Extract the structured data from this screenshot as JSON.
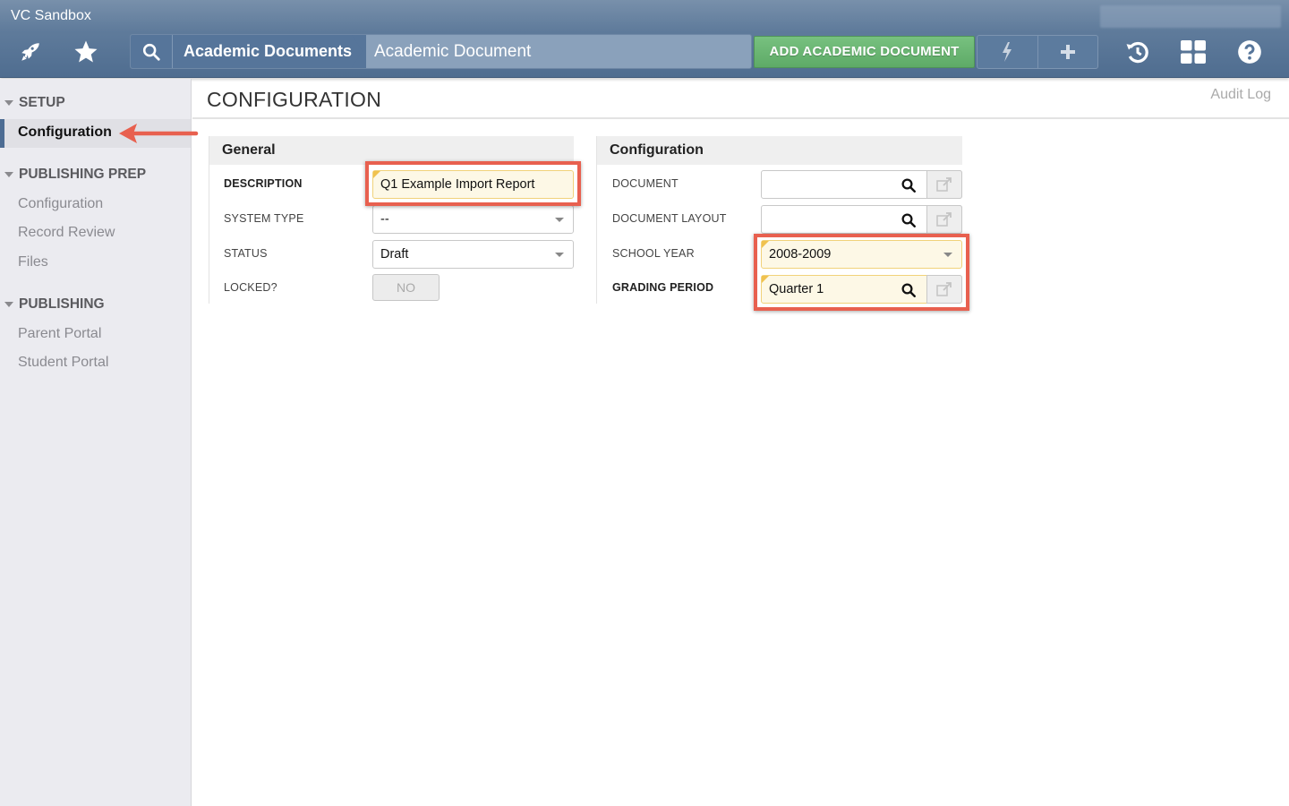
{
  "app": {
    "title": "VC Sandbox"
  },
  "header": {
    "icons": [
      "rocket-icon",
      "star-icon",
      "search-icon",
      "lightning-icon",
      "plus-icon",
      "history-icon",
      "apps-grid-icon",
      "help-icon"
    ],
    "breadcrumb": [
      "Academic Documents",
      "Academic Document"
    ],
    "add_button_label": "ADD ACADEMIC DOCUMENT"
  },
  "sidebar": {
    "sections": [
      {
        "label": "SETUP",
        "items": [
          {
            "label": "Configuration",
            "active": true
          }
        ]
      },
      {
        "label": "PUBLISHING PREP",
        "items": [
          {
            "label": "Configuration"
          },
          {
            "label": "Record Review"
          },
          {
            "label": "Files"
          }
        ]
      },
      {
        "label": "PUBLISHING",
        "items": [
          {
            "label": "Parent Portal"
          },
          {
            "label": "Student Portal"
          }
        ]
      }
    ]
  },
  "main": {
    "title": "CONFIGURATION",
    "audit_log_label": "Audit Log",
    "general": {
      "heading": "General",
      "fields": [
        {
          "label": "DESCRIPTION",
          "value": "Q1 Example Import Report",
          "required": true
        },
        {
          "label": "SYSTEM TYPE",
          "value": "--"
        },
        {
          "label": "STATUS",
          "value": "Draft"
        },
        {
          "label": "LOCKED?",
          "value": "NO"
        }
      ]
    },
    "configuration": {
      "heading": "Configuration",
      "fields": [
        {
          "label": "DOCUMENT",
          "value": ""
        },
        {
          "label": "DOCUMENT LAYOUT",
          "value": ""
        },
        {
          "label": "SCHOOL YEAR",
          "value": "2008-2009",
          "required": true
        },
        {
          "label": "GRADING PERIOD",
          "value": "Quarter 1",
          "required": true
        }
      ]
    }
  },
  "colors": {
    "header_blue": "#56759a",
    "add_button_green": "#6bb574",
    "annotation_red": "#e8604f",
    "required_field_bg": "#fdf8e6"
  }
}
